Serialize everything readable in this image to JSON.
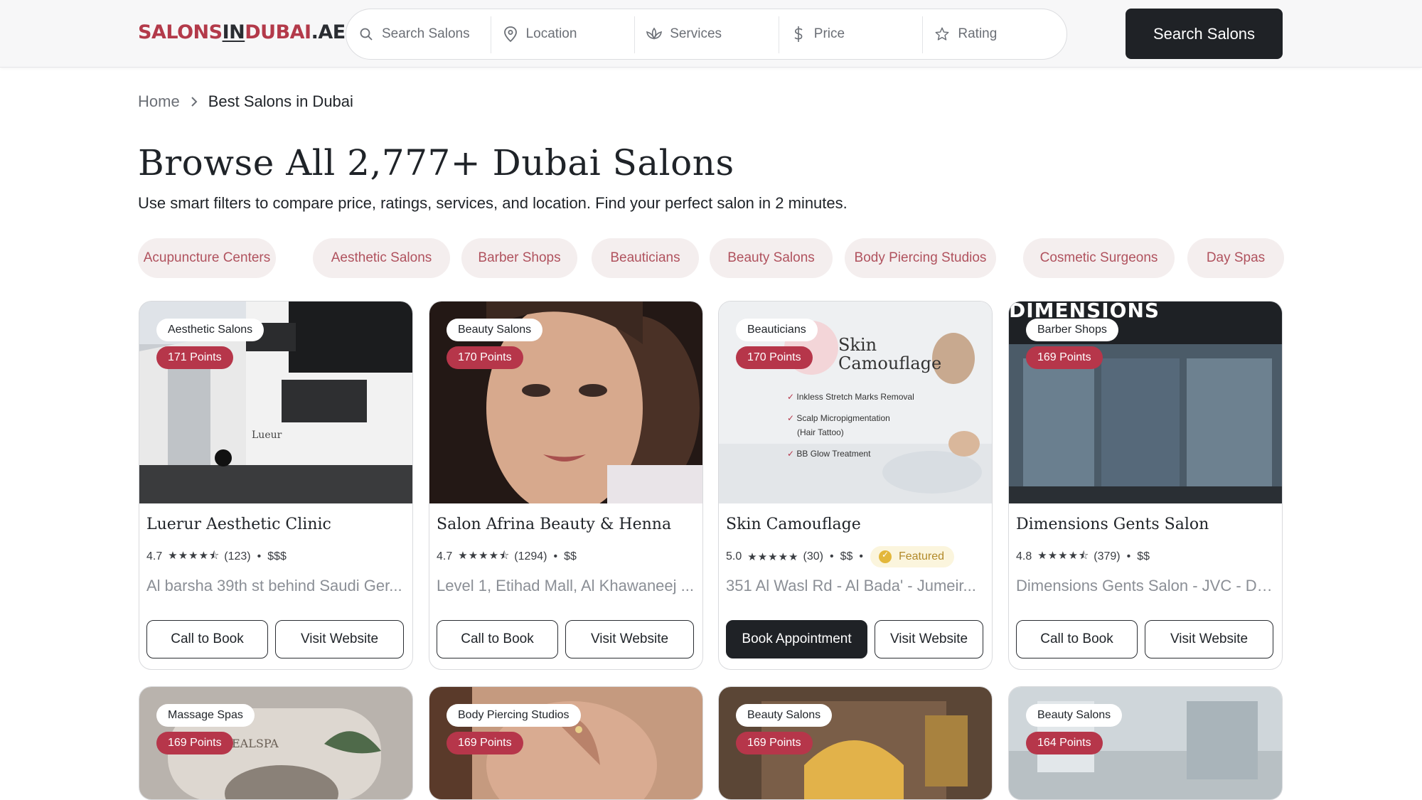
{
  "header": {
    "logo": {
      "part1": "SALONS",
      "part2": "IN",
      "part3": "DUBAI",
      "part4": ".AE"
    },
    "search": [
      {
        "icon": "search-icon",
        "placeholder": "Search Salons"
      },
      {
        "icon": "location-pin-icon",
        "placeholder": "Location"
      },
      {
        "icon": "lotus-icon",
        "placeholder": "Services"
      },
      {
        "icon": "dollar-icon",
        "placeholder": "Price"
      },
      {
        "icon": "star-icon",
        "placeholder": "Rating"
      }
    ],
    "search_button": "Search Salons"
  },
  "breadcrumb": {
    "home": "Home",
    "current": "Best Salons in Dubai"
  },
  "page": {
    "title": "Browse All 2,777+ Dubai Salons",
    "subtitle": "Use smart filters to compare price, ratings, services, and location. Find your perfect salon in 2 minutes."
  },
  "categories": [
    "Acupuncture Centers",
    "Aesthetic Salons",
    "Barber Shops",
    "Beauticians",
    "Beauty Salons",
    "Body Piercing Studios",
    "Cosmetic Surgeons",
    "Day Spas"
  ],
  "colors": {
    "accent": "#b6364a",
    "chip_bg": "#f4eeee",
    "chip_text": "#b0525e",
    "dark": "#1f2226",
    "featured_bg": "#fbf5dd"
  },
  "cards": [
    {
      "category": "Aesthetic Salons",
      "points": "171 Points",
      "name": "Luerur Aesthetic Clinic",
      "rating": "4.7",
      "stars": "★★★★⯪",
      "reviews": "(123)",
      "price": "$$$",
      "address": "Al barsha 39th st behind Saudi Ger...",
      "primary": "Call to Book",
      "secondary": "Visit Website"
    },
    {
      "category": "Beauty Salons",
      "points": "170 Points",
      "name": "Salon Afrina Beauty & Henna",
      "rating": "4.7",
      "stars": "★★★★⯪",
      "reviews": "(1294)",
      "price": "$$",
      "address": "Level 1, Etihad Mall, Al Khawaneej ...",
      "primary": "Call to Book",
      "secondary": "Visit Website"
    },
    {
      "category": "Beauticians",
      "points": "170 Points",
      "name": "Skin Camouflage",
      "rating": "5.0",
      "stars": "★★★★★",
      "reviews": "(30)",
      "price": "$$",
      "featured": "Featured",
      "address": "351 Al Wasl Rd - Al Bada' - Jumeir...",
      "primary": "Book Appointment",
      "secondary": "Visit Website"
    },
    {
      "category": "Barber Shops",
      "points": "169 Points",
      "name": "Dimensions Gents Salon",
      "rating": "4.8",
      "stars": "★★★★⯪",
      "reviews": "(379)",
      "price": "$$",
      "address": "Dimensions Gents Salon - JVC - Du...",
      "primary": "Call to Book",
      "secondary": "Visit Website"
    },
    {
      "category": "Massage Spas",
      "points": "169 Points"
    },
    {
      "category": "Body Piercing Studios",
      "points": "169 Points"
    },
    {
      "category": "Beauty Salons",
      "points": "169 Points"
    },
    {
      "category": "Beauty Salons",
      "points": "164 Points"
    }
  ],
  "image_text": {
    "skin_title_1": "Skin",
    "skin_title_2": "Camouflage",
    "skin_list": [
      "Inkless Stretch Marks Removal",
      "Scalp Micropigmentation",
      "(Hair Tattoo)",
      "BB Glow Treatment"
    ],
    "dimensions_sign": "DIMENSIONS",
    "luerur_sign": "Lueur",
    "spa_sign": "EALSPA"
  }
}
